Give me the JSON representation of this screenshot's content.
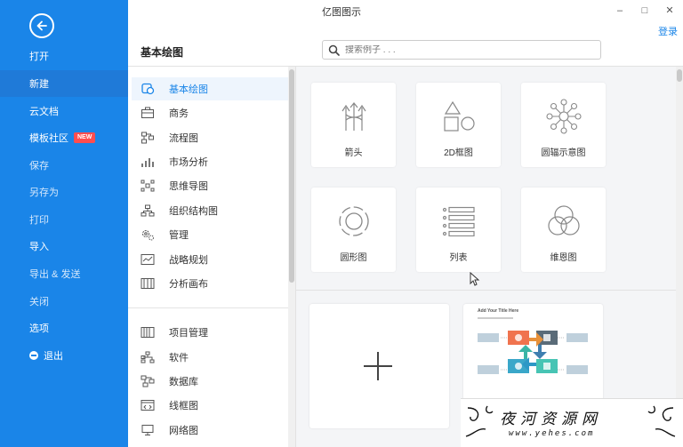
{
  "window": {
    "title": "亿图图示",
    "login": "登录",
    "minimize": "–",
    "maximize": "□",
    "close": "✕"
  },
  "sidebar": {
    "items": [
      {
        "label": "打开"
      },
      {
        "label": "新建"
      },
      {
        "label": "云文档"
      },
      {
        "label": "模板社区",
        "badge": "NEW"
      },
      {
        "label": "保存"
      },
      {
        "label": "另存为"
      },
      {
        "label": "打印"
      },
      {
        "label": "导入"
      },
      {
        "label": "导出 & 发送"
      },
      {
        "label": "关闭"
      },
      {
        "label": "选项"
      },
      {
        "label": "退出"
      }
    ]
  },
  "categories": {
    "header": "基本绘图",
    "items": [
      {
        "label": "基本绘图",
        "icon": "basic-drawing-icon"
      },
      {
        "label": "商务",
        "icon": "briefcase-icon"
      },
      {
        "label": "流程图",
        "icon": "flowchart-icon"
      },
      {
        "label": "市场分析",
        "icon": "bar-chart-icon"
      },
      {
        "label": "思维导图",
        "icon": "mindmap-icon"
      },
      {
        "label": "组织结构图",
        "icon": "org-chart-icon"
      },
      {
        "label": "管理",
        "icon": "gears-icon"
      },
      {
        "label": "战略规划",
        "icon": "strategy-icon"
      },
      {
        "label": "分析画布",
        "icon": "canvas-icon"
      },
      {
        "label": "项目管理",
        "icon": "project-icon"
      },
      {
        "label": "软件",
        "icon": "software-icon"
      },
      {
        "label": "数据库",
        "icon": "database-icon"
      },
      {
        "label": "线框图",
        "icon": "wireframe-icon"
      },
      {
        "label": "网络图",
        "icon": "network-icon"
      }
    ]
  },
  "search": {
    "placeholder": "搜索例子 . . ."
  },
  "types": [
    {
      "label": "箭头",
      "icon": "arrows-icon"
    },
    {
      "label": "2D框图",
      "icon": "shapes-2d-icon"
    },
    {
      "label": "圆辐示意图",
      "icon": "radial-icon"
    },
    {
      "label": "圆形图",
      "icon": "circular-icon"
    },
    {
      "label": "列表",
      "icon": "list-icon"
    },
    {
      "label": "维恩图",
      "icon": "venn-icon"
    }
  ],
  "templates": {
    "preview_title": "Add Your Title Here"
  },
  "watermark": {
    "title": "夜河资源网",
    "url": "www.yehes.com"
  },
  "colors": {
    "accent": "#1a85e8",
    "badge": "#ff4d4f"
  }
}
